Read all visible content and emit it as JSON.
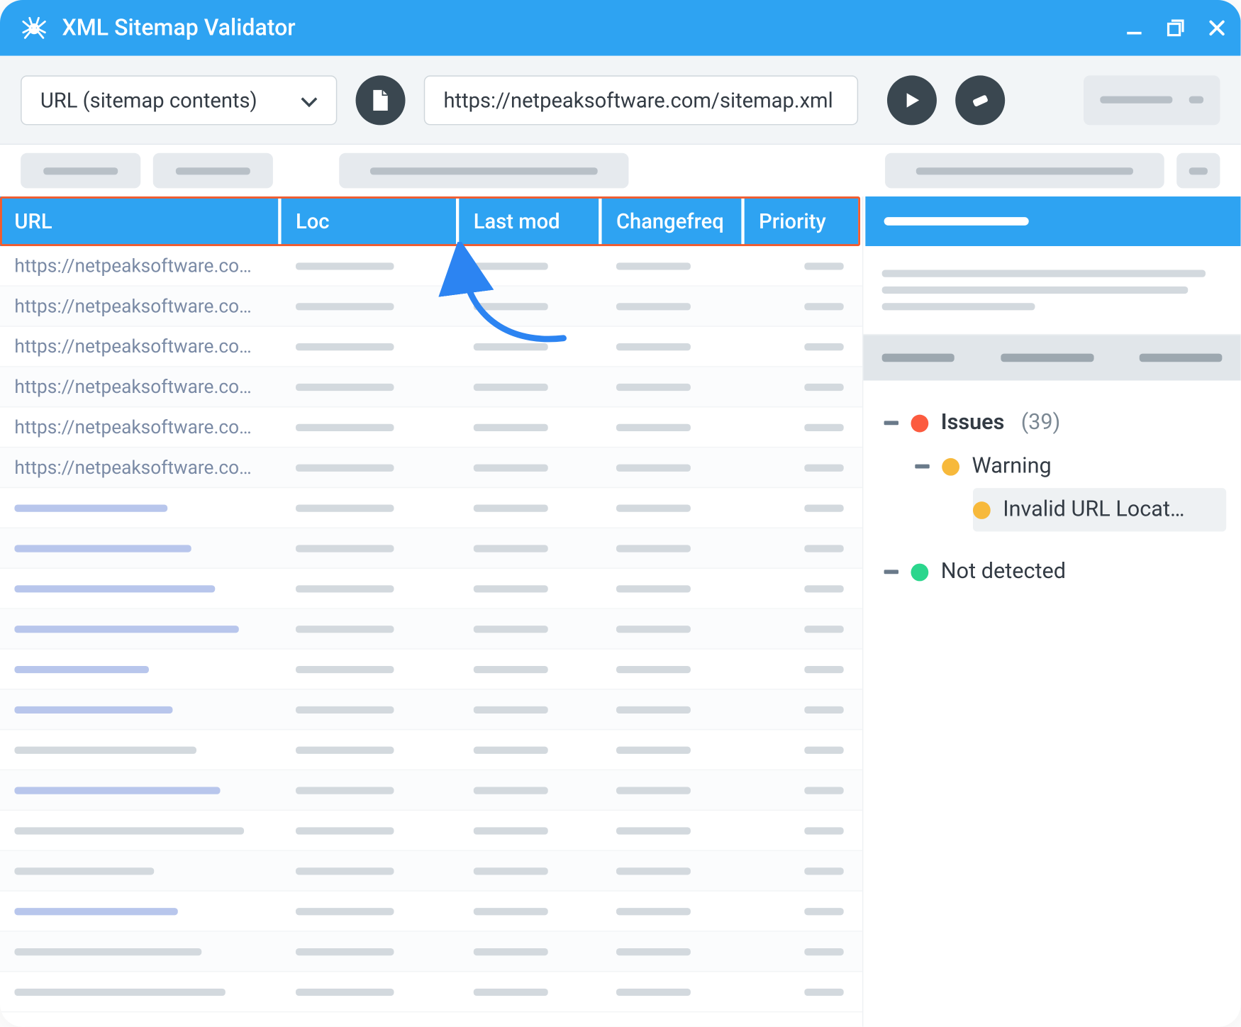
{
  "title": "XML Sitemap Validator",
  "toolbar": {
    "select_label": "URL (sitemap contents)",
    "url_value": "https://netpeaksoftware.com/sitemap.xml"
  },
  "table": {
    "columns": [
      "URL",
      "Loc",
      "Last mod",
      "Changefreq",
      "Priority"
    ],
    "rows": [
      {
        "url": "https://netpeaksoftware.co…",
        "blue": false
      },
      {
        "url": "https://netpeaksoftware.co…",
        "blue": false
      },
      {
        "url": "https://netpeaksoftware.co…",
        "blue": false
      },
      {
        "url": "https://netpeaksoftware.co…",
        "blue": false
      },
      {
        "url": "https://netpeaksoftware.co…",
        "blue": false
      },
      {
        "url": "https://netpeaksoftware.co…",
        "blue": false
      },
      {
        "url": "",
        "blue": true
      },
      {
        "url": "",
        "blue": true
      },
      {
        "url": "",
        "blue": true
      },
      {
        "url": "",
        "blue": true
      },
      {
        "url": "",
        "blue": true
      },
      {
        "url": "",
        "blue": true
      },
      {
        "url": "",
        "blue": false
      },
      {
        "url": "",
        "blue": true
      },
      {
        "url": "",
        "blue": false
      },
      {
        "url": "",
        "blue": false
      },
      {
        "url": "",
        "blue": true
      },
      {
        "url": "",
        "blue": false
      },
      {
        "url": "",
        "blue": false
      }
    ]
  },
  "issues": {
    "title": "Issues",
    "count_display": "(39)",
    "warning_label": "Warning",
    "details": [
      "Invalid URL Locat…"
    ],
    "not_detected_label": "Not detected"
  }
}
